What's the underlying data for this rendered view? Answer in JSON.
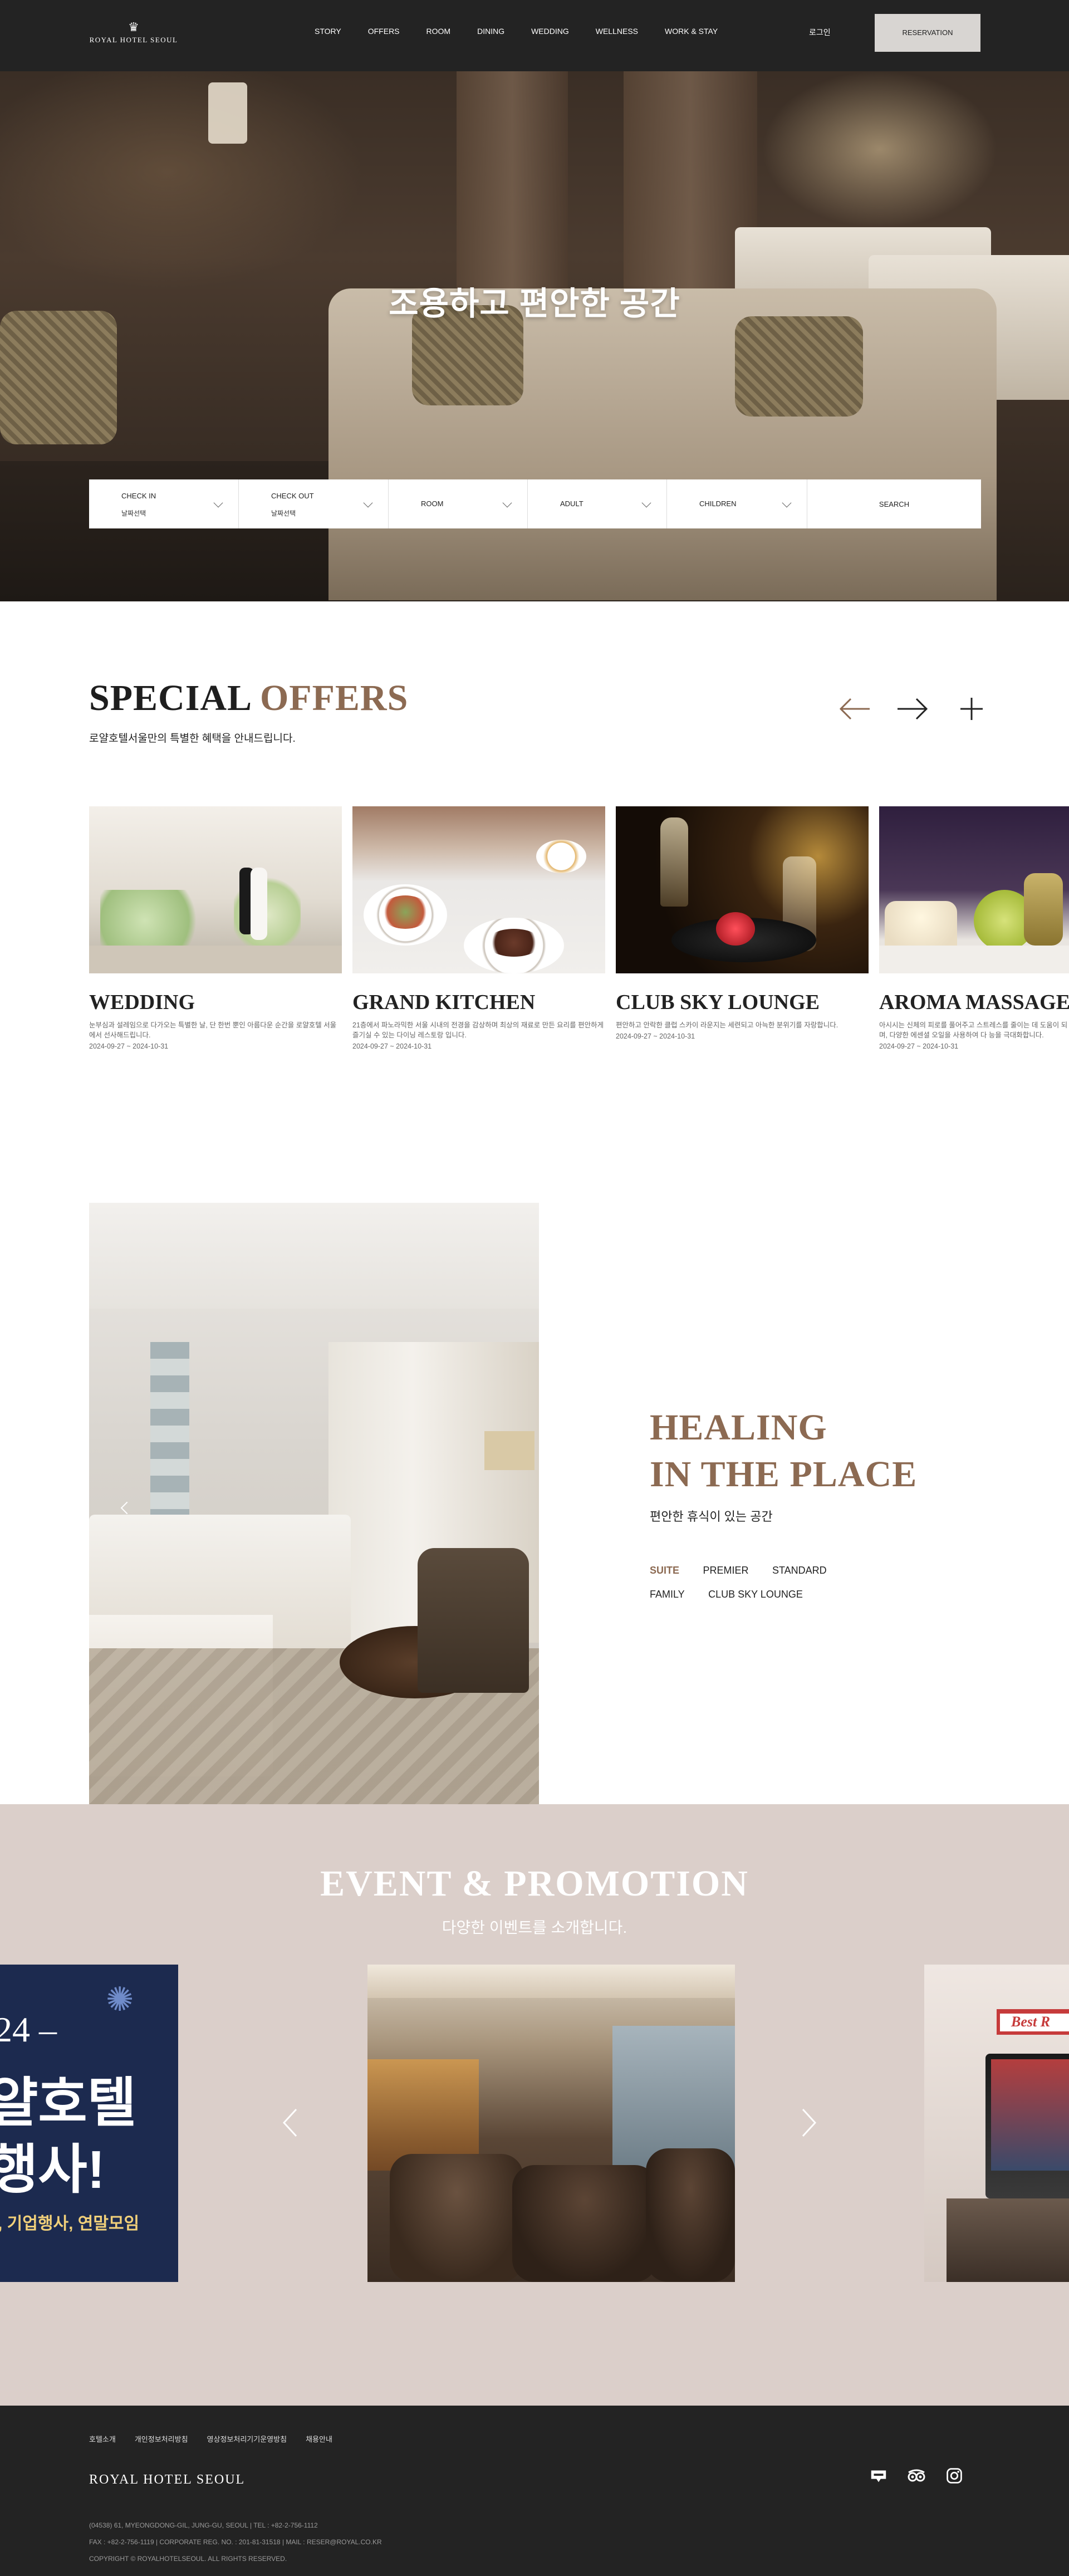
{
  "header": {
    "logo_text": "ROYAL HOTEL SEOUL",
    "nav": [
      "STORY",
      "OFFERS",
      "ROOM",
      "DINING",
      "WEDDING",
      "WELLNESS",
      "WORK & STAY"
    ],
    "login": "로그인",
    "reservation": "RESERVATION"
  },
  "hero": {
    "title": "조용하고 편안한 공간",
    "booking": {
      "check_in_label": "CHECK IN",
      "check_in_value": "날짜선택",
      "check_out_label": "CHECK OUT",
      "check_out_value": "날짜선택",
      "room": "ROOM",
      "adult": "ADULT",
      "children": "CHILDREN",
      "search": "SEARCH"
    }
  },
  "special_offers": {
    "title_main": "SPECIAL ",
    "title_accent": "OFFERS",
    "subtitle": "로얄호텔서울만의 특별한 혜택을 안내드립니다.",
    "items": [
      {
        "title": "WEDDING",
        "desc": "눈부심과 설레임으로 다가오는 특별한 날, 단 한번 뿐인 아름다운 순간을 로얄호텔 서울에서 선사해드립니다.",
        "date": "2024-09-27 ~ 2024-10-31"
      },
      {
        "title": "GRAND KITCHEN",
        "desc": "21층에서 파노라믹한 서울 시내의 전경을 감상하며 최상의 재료로 만든 요리를 편안하게 즐기실 수 있는 다이닝 레스토랑 입니다.",
        "date": "2024-09-27 ~ 2024-10-31"
      },
      {
        "title": "CLUB SKY LOUNGE",
        "desc": "편안하고 안락한 클럽 스카이 라운지는 세련되고 아늑한 분위기를 자랑합니다.",
        "date": "2024-09-27 ~ 2024-10-31"
      },
      {
        "title": "AROMA MASSAGE",
        "desc": "아시시는 신체의 피로를 풀어주고 스트레스를 줄이는 데 도움이 되며, 다양한 에센셜 오일을 사용하여 다 능을 극대화합니다.",
        "date": "2024-09-27 ~ 2024-10-31"
      }
    ]
  },
  "healing": {
    "title_line1": "HEALING",
    "title_line2": "IN THE PLACE",
    "subtitle": "편안한 휴식이 있는 공간",
    "tabs": [
      "SUITE",
      "PREMIER",
      "STANDARD",
      "FAMILY",
      "CLUB SKY LOUNGE"
    ],
    "active_tab": "SUITE"
  },
  "events": {
    "title": "EVENT & PROMOTION",
    "subtitle": "다양한 이벤트를 소개합니다.",
    "left_slide": {
      "year": "24 –",
      "line1": "얄호텔",
      "line2": "행사!",
      "line3": ", 기업행사, 연말모임"
    },
    "right_slide": {
      "tag": "Best R"
    }
  },
  "footer": {
    "links": [
      "호텔소개",
      "개인정보처리방침",
      "영상정보처리기기운영방침",
      "채용안내"
    ],
    "logo": "ROYAL HOTEL SEOUL",
    "info1": "(04538) 61, MYEONGDONG-GIL, JUNG-GU, SEOUL  |  TEL : +82-2-756-1112",
    "info2": "FAX : +82-2-756-1119  |  CORPORATE REG. NO. : 201-81-31518  |  MAIL : RESER@ROYAL.CO.KR",
    "copyright": "COPYRIGHT © ROYALHOTELSEOUL. ALL RIGHTS RESERVED."
  },
  "colors": {
    "accent": "#8c6a52",
    "header_bg": "#232323",
    "event_bg": "#dbcfca"
  }
}
